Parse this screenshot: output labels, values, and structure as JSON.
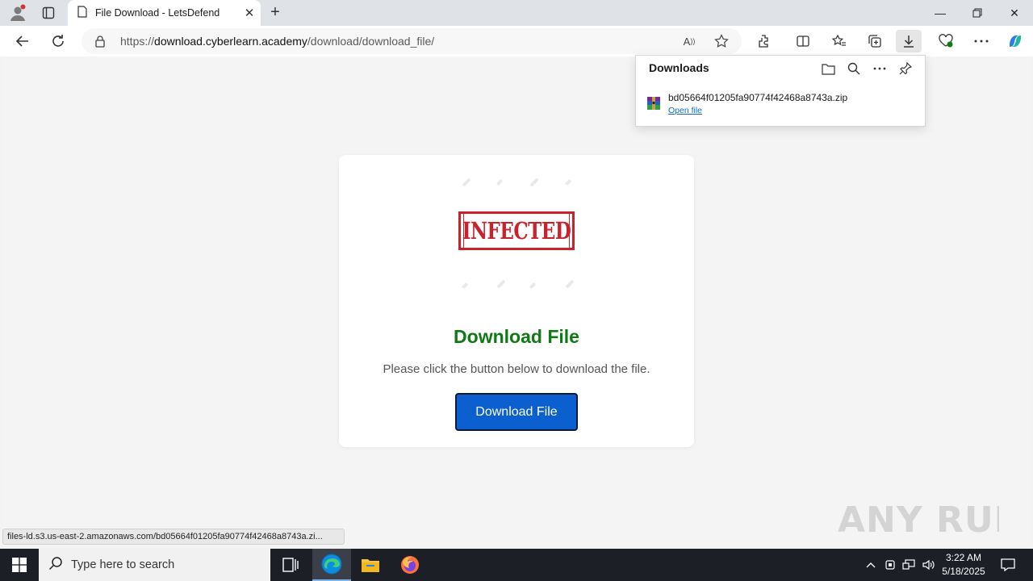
{
  "browser": {
    "tab_title": "File Download - LetsDefend",
    "url_prefix": "https://",
    "url_host": "download.cyberlearn.academy",
    "url_path": "/download/download_file/",
    "read_aloud_label": "A"
  },
  "page": {
    "stamp_text": "INFECTED",
    "title": "Download File",
    "instruction": "Please click the button below to download the file.",
    "button_label": "Download File"
  },
  "downloads": {
    "title": "Downloads",
    "file_name": "bd05664f01205fa90774f42468a8743a.zip",
    "open_label": "Open file"
  },
  "status_bar": {
    "text": "files-ld.s3.us-east-2.amazonaws.com/bd05664f01205fa90774f42468a8743a.zi..."
  },
  "watermark": {
    "text": "ANY RUN"
  },
  "taskbar": {
    "search_placeholder": "Type here to search",
    "time": "3:22 AM",
    "date": "5/18/2025"
  },
  "colors": {
    "accent": "#0b5fcf",
    "title_green": "#0d7a14",
    "stamp_red": "#c8232c",
    "link_blue": "#0f6cbd"
  }
}
